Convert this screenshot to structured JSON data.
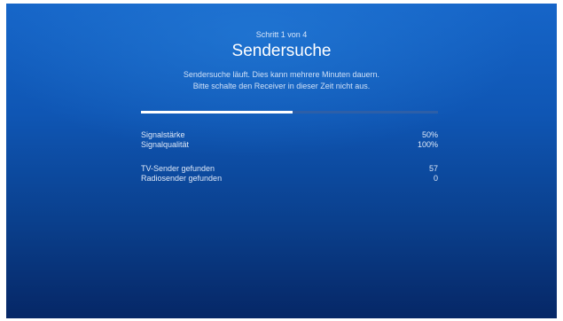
{
  "header": {
    "step": "Schritt 1 von 4",
    "title": "Sendersuche",
    "line1": "Sendersuche läuft. Dies kann mehrere Minuten dauern.",
    "line2": "Bitte schalte den Receiver in dieser Zeit nicht aus."
  },
  "progress": {
    "fraction": 0.51
  },
  "stats": {
    "signal_strength_label": "Signalstärke",
    "signal_strength_value": "50%",
    "signal_quality_label": "Signalqualität",
    "signal_quality_value": "100%",
    "tv_found_label": "TV-Sender gefunden",
    "tv_found_value": "57",
    "radio_found_label": "Radiosender gefunden",
    "radio_found_value": "0"
  },
  "colors": {
    "background_top": "#1665c8",
    "background_bottom": "#062766",
    "progress_fill": "#ffffff",
    "progress_track": "#2d5fa8"
  }
}
